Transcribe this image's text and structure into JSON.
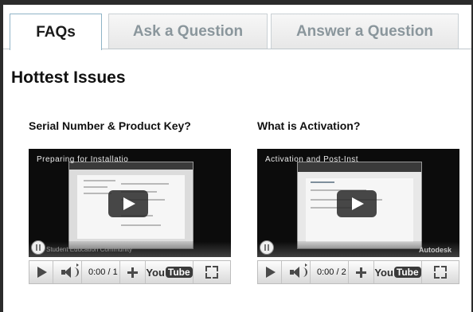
{
  "tabs": [
    {
      "label": "FAQs",
      "active": true
    },
    {
      "label": "Ask a Question",
      "active": false
    },
    {
      "label": "Answer a Question",
      "active": false
    }
  ],
  "heading": "Hottest Issues",
  "videos": [
    {
      "title": "Serial Number & Product Key?",
      "video_title": "Preparing for Installatio",
      "watermark": "Student Education Community",
      "time": "0:00 / 1",
      "youtube_label": "You",
      "youtube_tube": "Tube"
    },
    {
      "title": "What is Activation?",
      "video_title": "Activation and Post-Inst",
      "watermark": "Autodesk",
      "time": "0:00 / 2",
      "youtube_label": "You",
      "youtube_tube": "Tube"
    }
  ]
}
